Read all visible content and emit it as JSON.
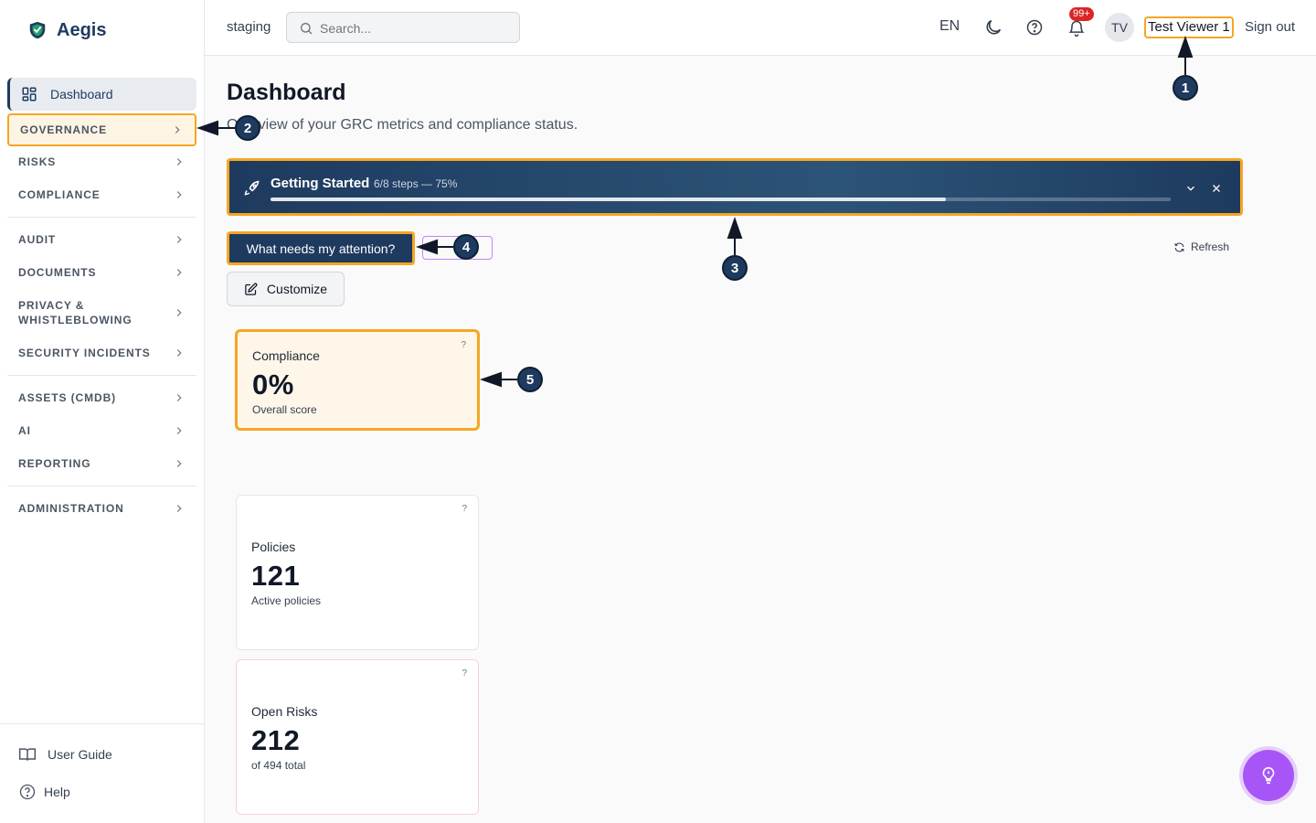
{
  "brand": {
    "name": "Aegis"
  },
  "sidebar": {
    "dashboard": "Dashboard",
    "sections": [
      {
        "label": "GOVERNANCE"
      },
      {
        "label": "RISKS"
      },
      {
        "label": "COMPLIANCE"
      },
      {
        "label": "AUDIT"
      },
      {
        "label": "DOCUMENTS"
      },
      {
        "label": "PRIVACY &",
        "label2": "WHISTLEBLOWING"
      },
      {
        "label": "SECURITY INCIDENTS"
      },
      {
        "label": "ASSETS (CMDB)"
      },
      {
        "label": "AI"
      },
      {
        "label": "REPORTING"
      },
      {
        "label": "ADMINISTRATION"
      }
    ],
    "bottom": {
      "guide": "User Guide",
      "help": "Help"
    }
  },
  "topbar": {
    "env": "staging",
    "search_placeholder": "Search...",
    "lang": "EN",
    "notif_badge": "99+",
    "avatar": "TV",
    "user": "Test Viewer 1",
    "signout": "Sign out"
  },
  "main": {
    "title": "Dashboard",
    "subtitle": "Overview of your GRC metrics and compliance status.",
    "getting_started": {
      "title": "Getting Started",
      "steps": "6/8 steps — 75%",
      "progress": 0.75
    },
    "attention_button": "What needs my attention?",
    "refresh": "Refresh",
    "customize": "Customize",
    "cards": [
      {
        "label": "Compliance",
        "value": "0%",
        "sub": "Overall score",
        "help": "?"
      },
      {
        "label": "Policies",
        "value": "121",
        "sub": "Active policies",
        "help": "?"
      },
      {
        "label": "Open Risks",
        "value": "212",
        "sub": "of 494 total",
        "help": "?"
      }
    ]
  },
  "annotations": [
    "1",
    "2",
    "3",
    "4",
    "5"
  ],
  "colors": {
    "primary": "#1e3a5f",
    "highlight": "#f5a623",
    "fab": "#a855f7",
    "badge": "#dc2626"
  }
}
